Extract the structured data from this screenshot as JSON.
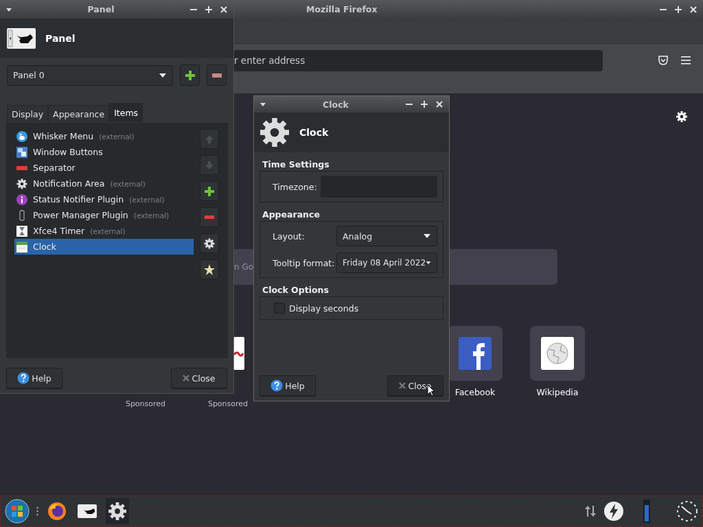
{
  "firefox": {
    "title": "Mozilla Firefox",
    "address_placeholder": "r enter address",
    "search_placeholder": "n Go",
    "sponsored_labels": [
      "Sponsored",
      "Sponsored"
    ],
    "shortcuts": [
      {
        "label": "Facebook",
        "kind": "facebook"
      },
      {
        "label": "Wikipedia",
        "kind": "wikipedia"
      }
    ]
  },
  "panel_window": {
    "title": "Panel",
    "header": "Panel",
    "panel_select": "Panel 0",
    "tabs": [
      {
        "label": "Display",
        "selected": false
      },
      {
        "label": "Appearance",
        "selected": false
      },
      {
        "label": "Items",
        "selected": true
      }
    ],
    "items": [
      {
        "name": "Whisker Menu",
        "note": "(external)",
        "kind": "whisker",
        "selected": false
      },
      {
        "name": "Window Buttons",
        "kind": "windows",
        "selected": false
      },
      {
        "name": "Separator",
        "kind": "separator",
        "selected": false
      },
      {
        "name": "Notification Area",
        "note": "(external)",
        "kind": "gear",
        "selected": false
      },
      {
        "name": "Status Notifier Plugin",
        "note": "(external)",
        "kind": "info",
        "selected": false
      },
      {
        "name": "Power Manager Plugin",
        "note": "(external)",
        "kind": "battery",
        "selected": false
      },
      {
        "name": "Xfce4 Timer",
        "note": "(external)",
        "kind": "hourglass",
        "selected": false
      },
      {
        "name": "Clock",
        "kind": "clock",
        "selected": true
      }
    ],
    "buttons": [
      "Help",
      "Close"
    ]
  },
  "clock_dialog": {
    "title": "Clock",
    "header": "Clock",
    "time_settings": {
      "heading": "Time Settings",
      "timezone_label": "Timezone:"
    },
    "appearance": {
      "heading": "Appearance",
      "layout_label": "Layout:",
      "layout_value": "Analog",
      "tooltip_label": "Tooltip format:",
      "tooltip_value": "Friday 08 April 2022"
    },
    "clock_options": {
      "heading": "Clock Options",
      "display_seconds": {
        "label": "Display seconds",
        "checked": false
      }
    },
    "buttons": [
      "Help",
      "Close"
    ]
  },
  "taskbar": {
    "launchers": [
      {
        "kind": "firefox",
        "selected": false
      },
      {
        "kind": "mouse",
        "selected": false
      },
      {
        "kind": "gear",
        "selected": true
      }
    ]
  }
}
